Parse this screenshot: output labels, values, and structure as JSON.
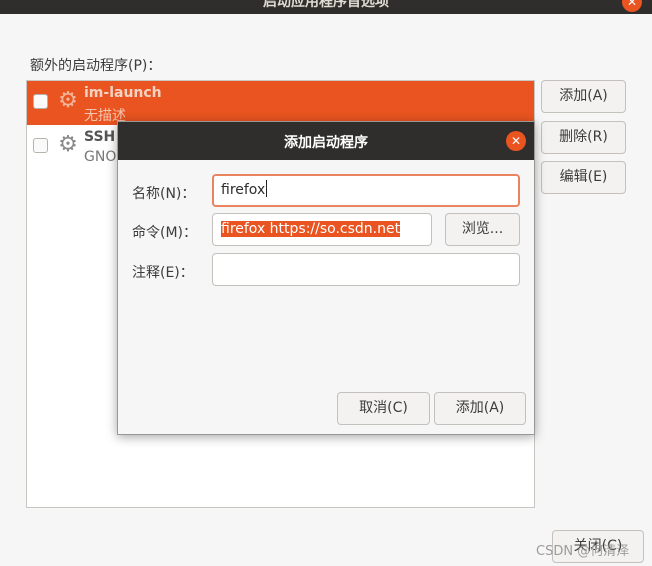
{
  "window": {
    "title": "启动应用程序首选项",
    "close_glyph": "✕"
  },
  "main": {
    "list_label": "额外的启动程序(P)：",
    "items": [
      {
        "name": "im-launch",
        "description": "无描述",
        "selected": true
      },
      {
        "name": "SSH",
        "description": "GNO",
        "selected": false
      }
    ],
    "buttons": {
      "add": "添加(A)",
      "remove": "删除(R)",
      "edit": "编辑(E)",
      "close": "关闭(C)"
    }
  },
  "dialog": {
    "title": "添加启动程序",
    "close_glyph": "✕",
    "name_label": "名称(N)：",
    "name_value": "firefox",
    "command_label": "命令(M)：",
    "command_value": "firefox  https://so.csdn.net",
    "browse_label": "浏览...",
    "comment_label": "注释(E)：",
    "comment_value": "",
    "cancel_label": "取消(C)",
    "add_label": "添加(A)"
  },
  "watermark": "CSDN @何清泽",
  "icons": {
    "item_icon": "gear-icon",
    "gear_glyph": "⚙"
  },
  "colors": {
    "accent": "#e95420",
    "titlebar": "#2f2e2c"
  }
}
